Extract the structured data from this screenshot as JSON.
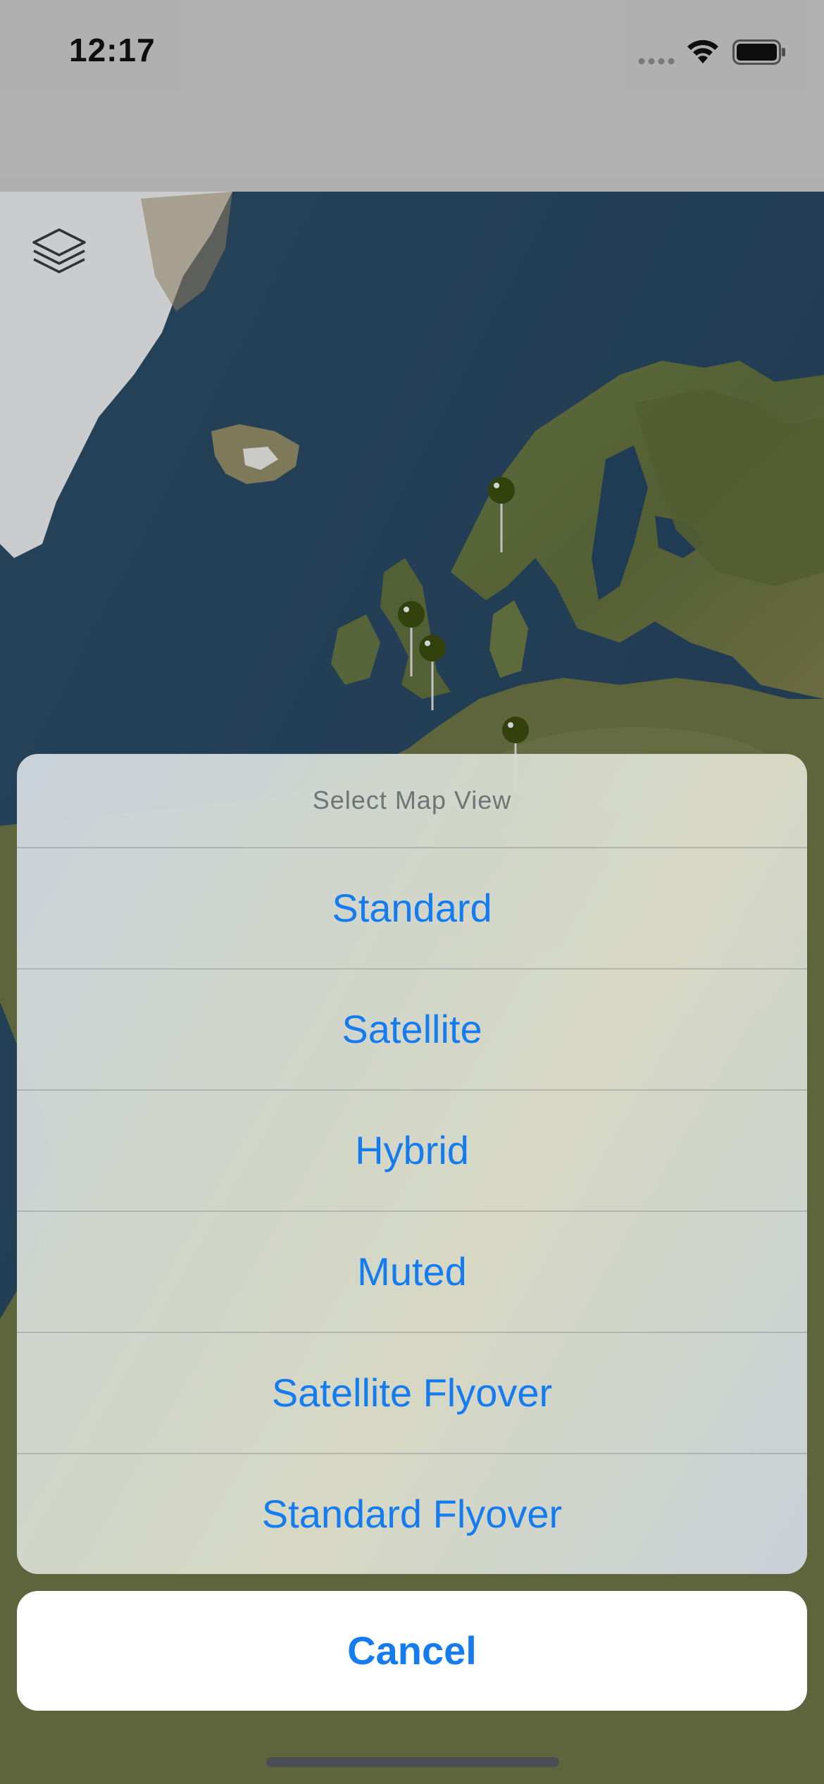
{
  "status_bar": {
    "time": "12:17"
  },
  "map": {
    "layers_icon": "layers-icon",
    "pins": [
      "map-pin",
      "map-pin",
      "map-pin",
      "map-pin"
    ]
  },
  "action_sheet": {
    "title": "Select Map View",
    "options": [
      {
        "label": "Standard"
      },
      {
        "label": "Satellite"
      },
      {
        "label": "Hybrid"
      },
      {
        "label": "Muted"
      },
      {
        "label": "Satellite Flyover"
      },
      {
        "label": "Standard Flyover"
      }
    ],
    "cancel_label": "Cancel",
    "accent_color": "#157cf0"
  }
}
